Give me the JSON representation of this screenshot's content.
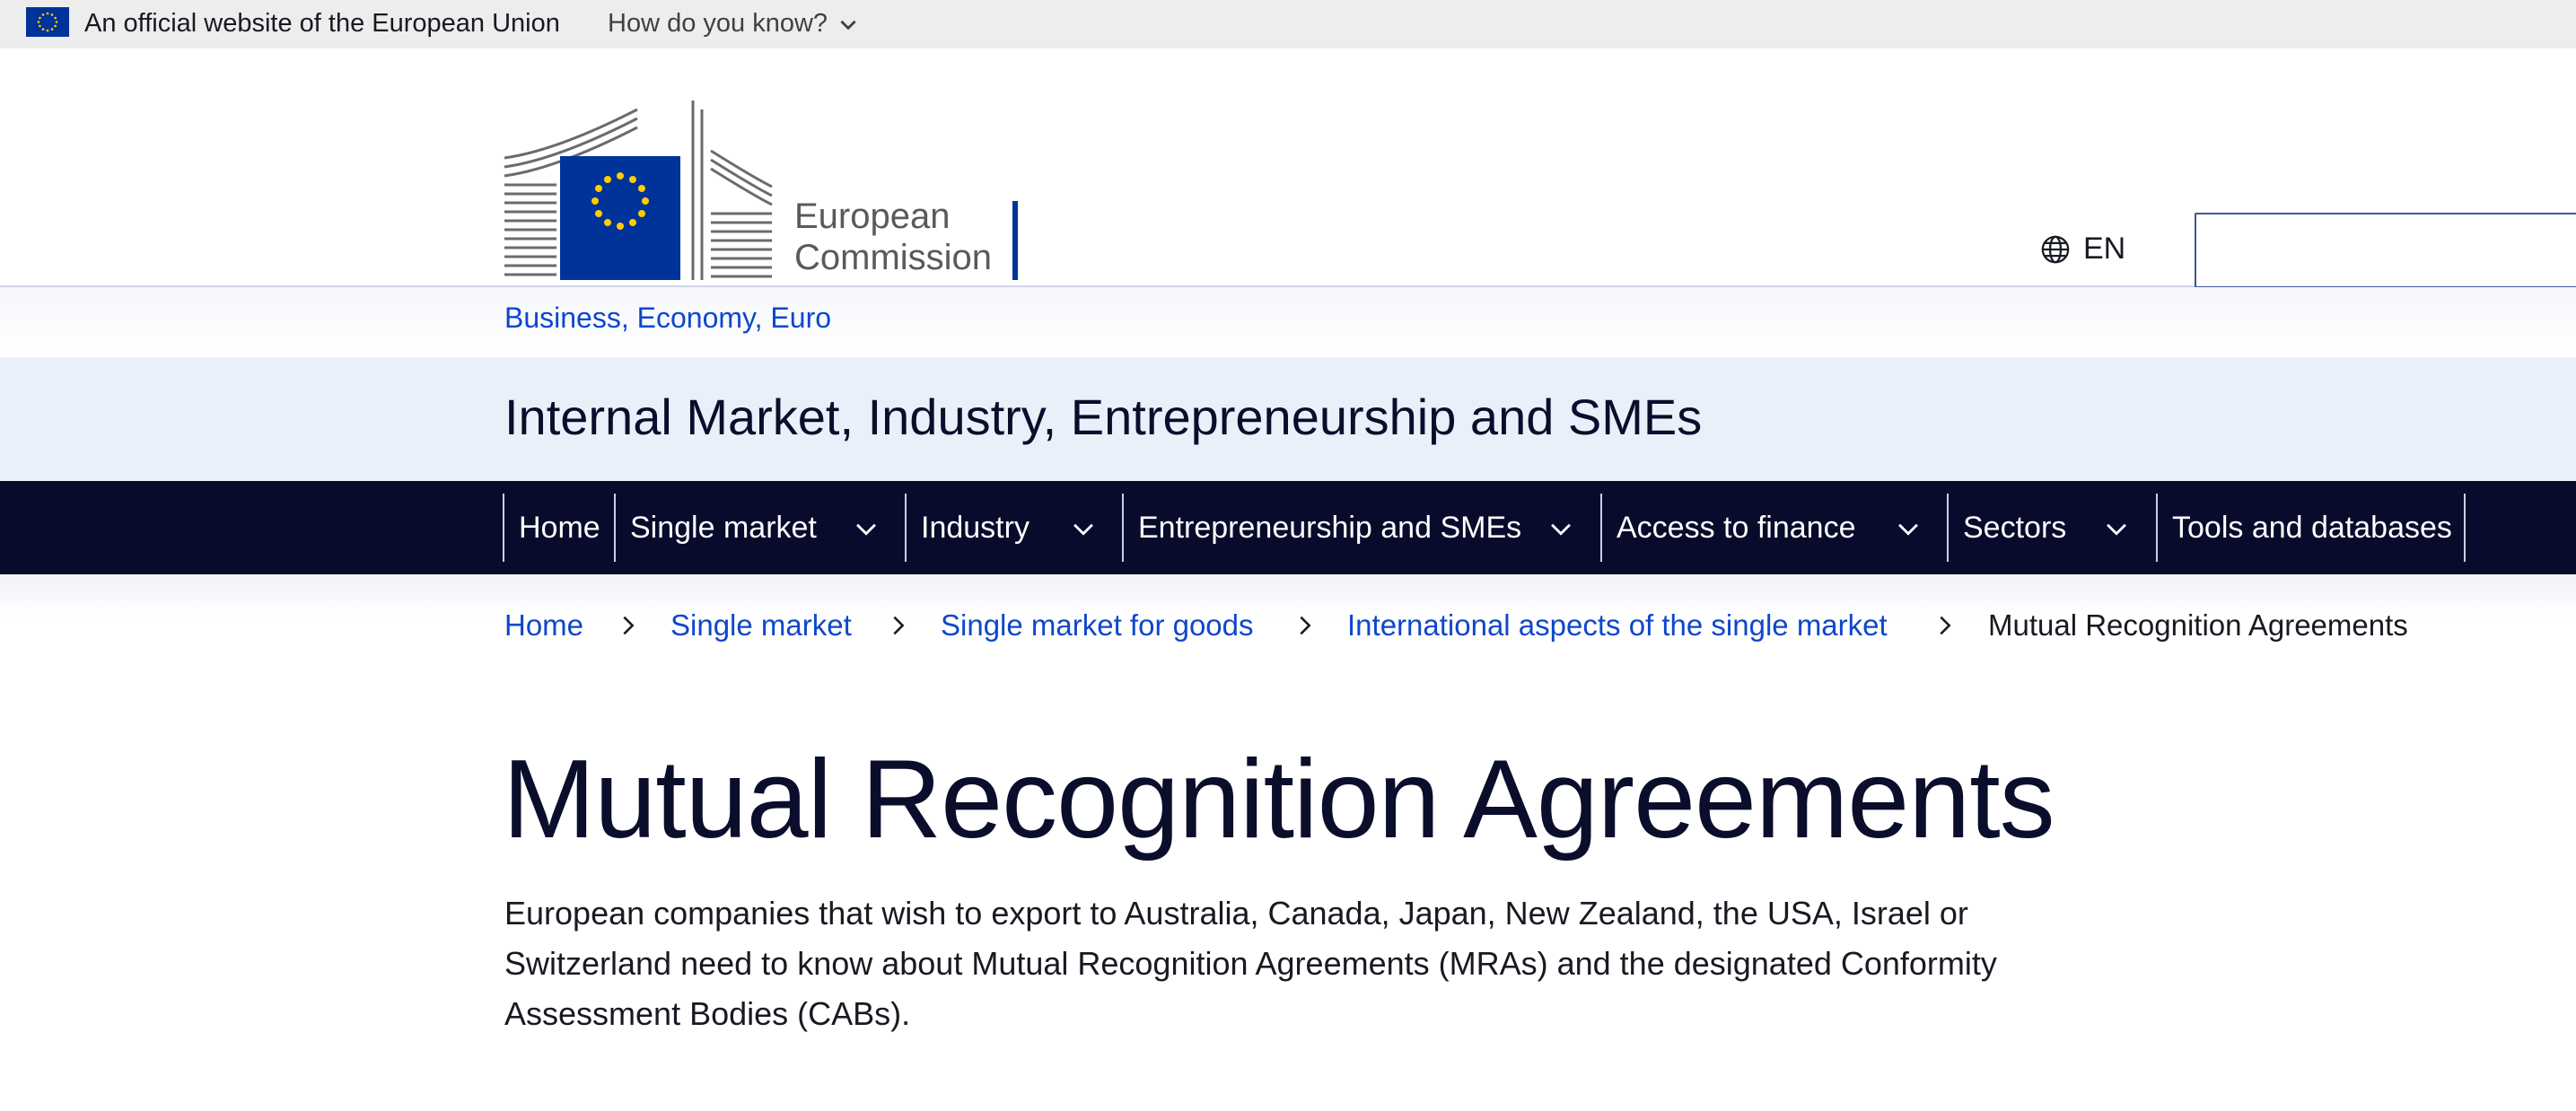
{
  "topbar": {
    "official_text": "An official website of the European Union",
    "how_know": "How do you know?"
  },
  "header": {
    "logo_text_line1": "European",
    "logo_text_line2": "Commission",
    "language": "EN",
    "search_placeholder": ""
  },
  "site": {
    "parent_link": "Business, Economy, Euro",
    "name": "Internal Market, Industry, Entrepreneurship and SMEs"
  },
  "nav": {
    "items": [
      {
        "label": "Home",
        "has_menu": false
      },
      {
        "label": "Single market",
        "has_menu": true
      },
      {
        "label": "Industry",
        "has_menu": true
      },
      {
        "label": "Entrepreneurship and SMEs",
        "has_menu": true
      },
      {
        "label": "Access to finance",
        "has_menu": true
      },
      {
        "label": "Sectors",
        "has_menu": true
      },
      {
        "label": "Tools and databases",
        "has_menu": false
      }
    ]
  },
  "breadcrumb": {
    "items": [
      "Home",
      "Single market",
      "Single market for goods",
      "International aspects of the single market",
      "Mutual Recognition Agreements"
    ]
  },
  "page": {
    "title": "Mutual Recognition Agreements",
    "lead": "European companies that wish to export to Australia, Canada, Japan, New Zealand, the USA, Israel or Switzerland need to know about Mutual Recognition Agreements (MRAs) and the designated Conformity Assessment Bodies (CABs)."
  },
  "colors": {
    "eu_blue": "#003399",
    "eu_yellow": "#ffcc00",
    "link_blue": "#0e47cb",
    "nav_bg": "#080b2b",
    "site_band_bg": "#eaf0fa"
  },
  "icons": [
    "eu-flag-icon",
    "chevron-down-icon",
    "globe-icon",
    "chevron-right-icon"
  ]
}
